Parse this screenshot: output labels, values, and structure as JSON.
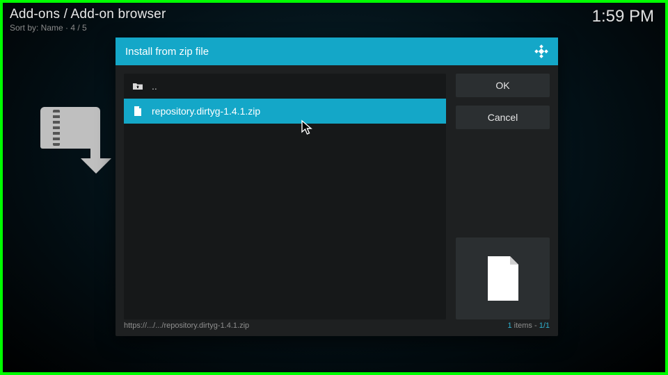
{
  "header": {
    "breadcrumb": "Add-ons / Add-on browser",
    "sort_line": "Sort by: Name  ·  4 / 5"
  },
  "clock": "1:59 PM",
  "dialog": {
    "title": "Install from zip file",
    "parent_label": "..",
    "items": [
      {
        "name": "repository.dirtyg-1.4.1.zip",
        "selected": true
      }
    ],
    "buttons": {
      "ok": "OK",
      "cancel": "Cancel"
    },
    "status_path": "https://.../.../repository.dirtyg-1.4.1.zip",
    "status_count_prefix": "1",
    "status_count_word": " items - ",
    "status_count_page": "1/1"
  }
}
